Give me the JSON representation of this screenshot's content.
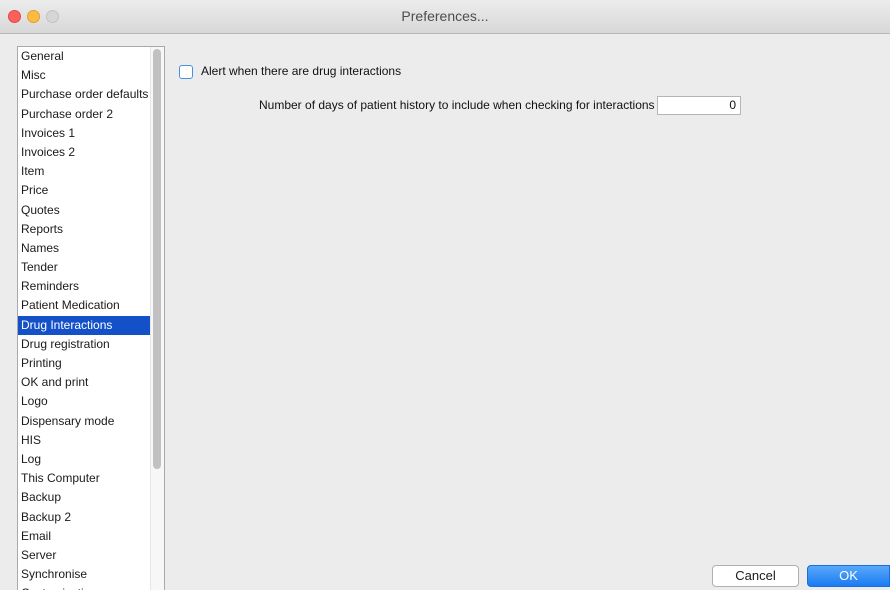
{
  "window": {
    "title": "Preferences..."
  },
  "sidebar": {
    "selected_index": 14,
    "items": [
      {
        "label": "General"
      },
      {
        "label": "Misc"
      },
      {
        "label": "Purchase order defaults"
      },
      {
        "label": "Purchase order 2"
      },
      {
        "label": "Invoices 1"
      },
      {
        "label": "Invoices 2"
      },
      {
        "label": "Item"
      },
      {
        "label": "Price"
      },
      {
        "label": "Quotes"
      },
      {
        "label": "Reports"
      },
      {
        "label": "Names"
      },
      {
        "label": "Tender"
      },
      {
        "label": "Reminders"
      },
      {
        "label": "Patient Medication"
      },
      {
        "label": "Drug Interactions"
      },
      {
        "label": "Drug registration"
      },
      {
        "label": "Printing"
      },
      {
        "label": "OK and print"
      },
      {
        "label": "Logo"
      },
      {
        "label": "Dispensary mode"
      },
      {
        "label": "HIS"
      },
      {
        "label": "Log"
      },
      {
        "label": "This Computer"
      },
      {
        "label": "Backup"
      },
      {
        "label": "Backup 2"
      },
      {
        "label": "Email"
      },
      {
        "label": "Server"
      },
      {
        "label": "Synchronise"
      },
      {
        "label": "Customisation"
      }
    ]
  },
  "drug_interactions": {
    "alert_label": "Alert when there are drug interactions",
    "alert_checked": false,
    "days_label": "Number of days of patient history to include when checking for interactions",
    "days_value": "0"
  },
  "buttons": {
    "cancel": "Cancel",
    "ok": "OK"
  }
}
